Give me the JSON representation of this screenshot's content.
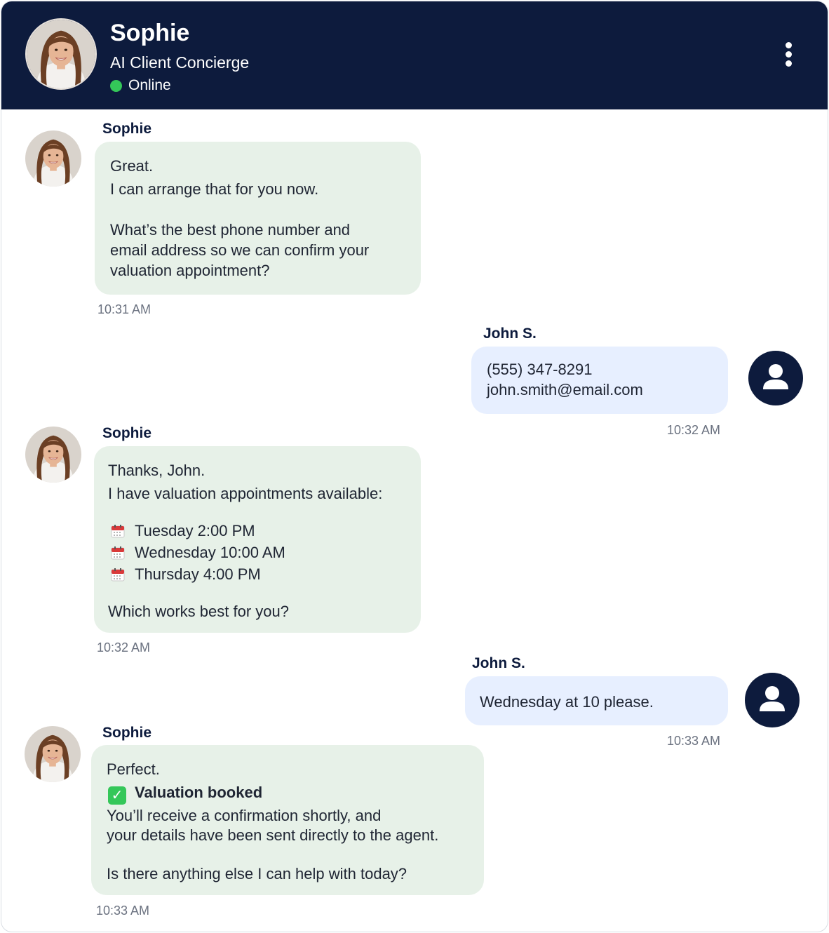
{
  "header": {
    "name": "Sophie",
    "role": "AI Client Concierge",
    "status": "Online",
    "status_color": "#34c759",
    "menu_icon": "more-vertical-icon"
  },
  "colors": {
    "header_bg": "#0d1b3d",
    "bot_bubble": "#e7f1e8",
    "user_bubble": "#e7efff"
  },
  "messages": [
    {
      "sender": "Sophie",
      "lines": [
        "Great.",
        "I can arrange that for you now.",
        "What’s the best phone number and",
        "email address so we can confirm your",
        "valuation appointment?"
      ],
      "time": "10:31 AM"
    },
    {
      "sender": "John S.",
      "lines": [
        "(555) 347-8291",
        "john.smith@email.com"
      ],
      "time": "10:32 AM"
    },
    {
      "sender": "Sophie",
      "lines": [
        "Thanks, John.",
        "I have valuation appointments available:",
        "Tuesday 2:00 PM",
        "Wednesday 10:00 AM",
        "Thursday 4:00 PM",
        "Which works best for you?"
      ],
      "time": "10:32 AM"
    },
    {
      "sender": "John S.",
      "lines": [
        "Wednesday at 10 please."
      ],
      "time": "10:33 AM"
    },
    {
      "sender": "Sophie",
      "lines": [
        "Perfect.",
        "Valuation booked",
        "You’ll receive a confirmation shortly, and",
        "your details have been sent directly to the agent.",
        "Is there anything else I can help with today?"
      ],
      "time": "10:33 AM"
    }
  ]
}
